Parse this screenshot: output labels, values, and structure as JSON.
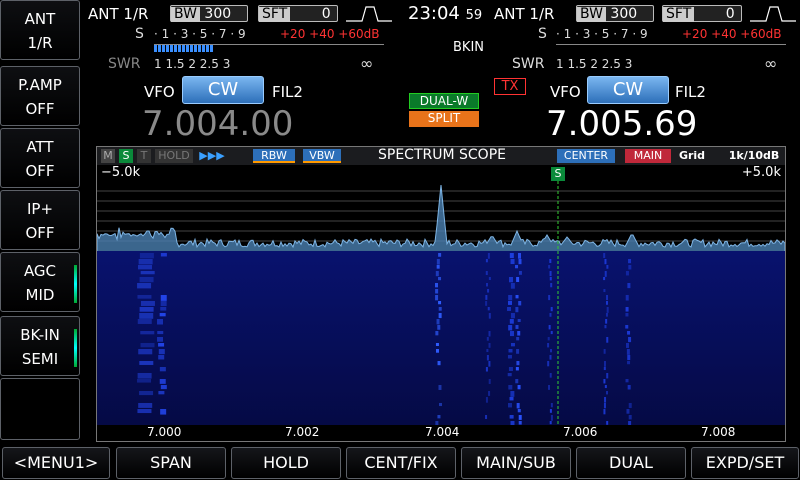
{
  "left_keys": [
    {
      "line1": "ANT",
      "line2": "1/R"
    },
    {
      "line1": "P.AMP",
      "line2": "OFF"
    },
    {
      "line1": "ATT",
      "line2": "OFF"
    },
    {
      "line1": "IP+",
      "line2": "OFF"
    },
    {
      "line1": "AGC",
      "line2": "MID"
    },
    {
      "line1": "BK-IN",
      "line2": "SEMI"
    }
  ],
  "left_panel": {
    "ant": "ANT 1/R",
    "bw_label": "BW",
    "bw_value": "300",
    "sft_label": "SFT",
    "sft_value": "0",
    "vfo": "VFO",
    "mode": "CW",
    "filter": "FIL2",
    "frequency": "7.004.00"
  },
  "right_panel": {
    "ant": "ANT 1/R",
    "bw_label": "BW",
    "bw_value": "300",
    "sft_label": "SFT",
    "sft_value": "0",
    "vfo": "VFO",
    "mode": "CW",
    "filter": "FIL2",
    "frequency": "7.005.69"
  },
  "clock": {
    "hhmm": "23:04",
    "ss": "59"
  },
  "center": {
    "bkin": "BKIN",
    "tx": "TX",
    "dual_w": "DUAL-W",
    "split": "SPLIT"
  },
  "meter": {
    "s_label": "S",
    "s_scale": "· 1 · 3 · 5 · 7 · 9",
    "s_over": "+20 +40 +60dB",
    "swr_label": "SWR",
    "swr_scale": "1   1.5   2   2.5   3",
    "swr_inf": "∞"
  },
  "scope": {
    "flags": [
      "M",
      "S",
      "T",
      "HOLD"
    ],
    "arrows": "▶▶▶",
    "rbw": "RBW",
    "vbw": "VBW",
    "title": "SPECTRUM SCOPE",
    "center": "CENTER",
    "main": "MAIN",
    "grid": "Grid",
    "scale": "1k/10dB",
    "left_edge": "−5.0k",
    "right_edge": "+5.0k",
    "s_marker": "S",
    "freq_ticks": [
      "7.000",
      "7.002",
      "7.004",
      "7.006",
      "7.008"
    ]
  },
  "bottom_keys": [
    "<MENU1>",
    "SPAN",
    "HOLD",
    "CENT/FIX",
    "MAIN/SUB",
    "DUAL",
    "EXPD/SET"
  ],
  "colors": {
    "accent_blue": "#2d6fb9",
    "tx_red": "#ff3333",
    "dual_green": "#0a7a2a",
    "split_orange": "#e8731a",
    "waterfall": "#0a1a8a"
  }
}
